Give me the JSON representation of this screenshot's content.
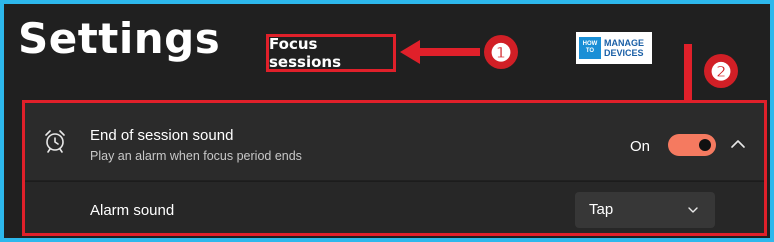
{
  "window": {
    "title": "Settings"
  },
  "section": {
    "label": "Focus sessions"
  },
  "annotations": {
    "badge1": "❶",
    "badge2": "❷",
    "marker_color": "#e0202a"
  },
  "logo": {
    "line1": "HOW",
    "line2": "TO",
    "line3": "MANAGE",
    "line4": "DEVICES"
  },
  "setting": {
    "icon": "alarm-clock-icon",
    "title": "End of session sound",
    "description": "Play an alarm when focus period ends",
    "state_label": "On",
    "toggle_on": true,
    "accent": "#f57a60"
  },
  "alarm": {
    "label": "Alarm sound",
    "selected": "Tap"
  }
}
